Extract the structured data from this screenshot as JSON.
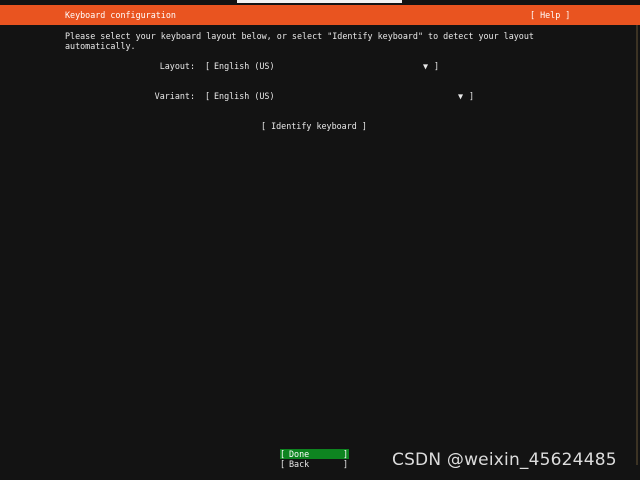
{
  "header": {
    "title": "Keyboard configuration",
    "help_label": "[ Help ]"
  },
  "instructions": "Please select your keyboard layout below, or select \"Identify keyboard\" to detect your layout\nautomatically.",
  "form": {
    "layout_label": "Layout:",
    "layout_value": "English (US)",
    "variant_label": "Variant:",
    "variant_value": "English (US)",
    "identify_label": "[ Identify keyboard ]"
  },
  "footer": {
    "done_label": "Done",
    "back_label": "Back"
  },
  "watermark": "CSDN @weixin_45624485",
  "colors": {
    "accent": "#e95420",
    "selected_button": "#0e8420",
    "background": "#131313",
    "text": "#e8e8e8"
  }
}
